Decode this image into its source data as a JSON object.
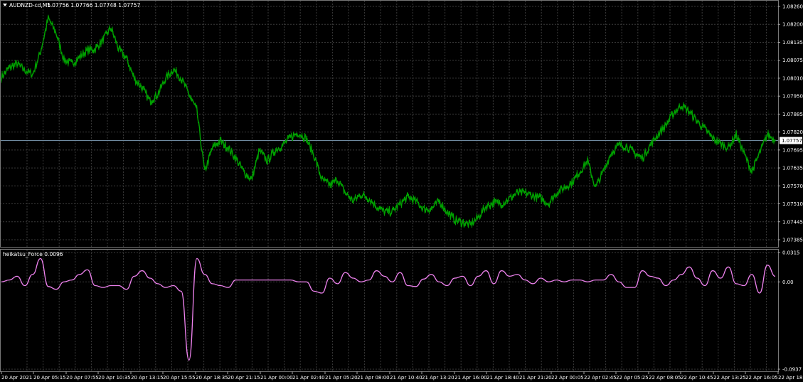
{
  "header": {
    "symbol_label": "AUDNZD-cd,M5",
    "ohlc_label": "1.07756 1.07766 1.07748 1.07757"
  },
  "indicator": {
    "label": "heikatsu_Force 0.0096"
  },
  "colors": {
    "background": "#000000",
    "grid": "#3a3a3a",
    "price_line": "#00a000",
    "indicator_line": "#ee82ee",
    "current_price_line": "#6f8aa0"
  },
  "chart_data": [
    {
      "type": "line",
      "title": "AUDNZD-cd,M5",
      "yticks": [
        "1.08260",
        "1.08200",
        "1.08135",
        "1.08075",
        "1.08010",
        "1.07950",
        "1.07885",
        "1.07820",
        "1.07695",
        "1.07635",
        "1.07570",
        "1.07510",
        "1.07445",
        "1.07385"
      ],
      "current_price": "1.07757",
      "ylim": [
        1.07385,
        1.0826
      ],
      "grid": true,
      "x": [
        0,
        1,
        2,
        3,
        4,
        5,
        6,
        7,
        8,
        9,
        10,
        11,
        12,
        13,
        14,
        15,
        16,
        17,
        18,
        19,
        20,
        21,
        22,
        23,
        24,
        25,
        26,
        27,
        28,
        29,
        30,
        31,
        32,
        33,
        34,
        35,
        36,
        37,
        38,
        39,
        40,
        41,
        42,
        43,
        44,
        45,
        46,
        47,
        48,
        49,
        50,
        51,
        52,
        53,
        54,
        55,
        56,
        57,
        58,
        59,
        60,
        61,
        62,
        63,
        64,
        65,
        66,
        67,
        68,
        69,
        70,
        71,
        72,
        73,
        74,
        75,
        76,
        77,
        78,
        79,
        80,
        81,
        82,
        83,
        84,
        85,
        86,
        87,
        88,
        89,
        90,
        91,
        92,
        93,
        94,
        95,
        96,
        97,
        98,
        99
      ],
      "values": [
        1.07995,
        1.0803,
        1.08045,
        1.0802,
        1.08005,
        1.0809,
        1.08215,
        1.0816,
        1.0806,
        1.08045,
        1.0807,
        1.08095,
        1.081,
        1.08135,
        1.0818,
        1.081,
        1.08065,
        1.0799,
        1.07955,
        1.07905,
        1.0793,
        1.0799,
        1.08025,
        1.0799,
        1.0793,
        1.0787,
        1.0764,
        1.0773,
        1.07755,
        1.0773,
        1.0769,
        1.0764,
        1.0761,
        1.0772,
        1.0768,
        1.0772,
        1.0774,
        1.0777,
        1.07785,
        1.07765,
        1.077,
        1.0761,
        1.0759,
        1.0761,
        1.0756,
        1.0753,
        1.07555,
        1.0754,
        1.0751,
        1.0749,
        1.0749,
        1.0752,
        1.07545,
        1.0753,
        1.075,
        1.075,
        1.0753,
        1.0749,
        1.0746,
        1.0745,
        1.0744,
        1.0747,
        1.0751,
        1.07525,
        1.0752,
        1.0754,
        1.0756,
        1.0756,
        1.0755,
        1.0754,
        1.0752,
        1.0756,
        1.0758,
        1.076,
        1.0764,
        1.0768,
        1.0758,
        1.0764,
        1.0771,
        1.0774,
        1.07735,
        1.0771,
        1.0769,
        1.0774,
        1.0778,
        1.07815,
        1.0786,
        1.0789,
        1.07865,
        1.0783,
        1.078,
        1.07765,
        1.07745,
        1.0773,
        1.0778,
        1.0771,
        1.0764,
        1.0771,
        1.0778,
        1.07757
      ]
    },
    {
      "type": "line",
      "title": "heikatsu_Force 0.0096",
      "yticks": [
        "0.0315",
        "0.00",
        "-0.0937"
      ],
      "ylim": [
        -0.0937,
        0.0315
      ],
      "grid": true,
      "x": [
        0,
        1,
        2,
        3,
        4,
        5,
        6,
        7,
        8,
        9,
        10,
        11,
        12,
        13,
        14,
        15,
        16,
        17,
        18,
        19,
        20,
        21,
        22,
        23,
        24,
        25,
        26,
        27,
        28,
        29,
        30,
        31,
        32,
        33,
        34,
        35,
        36,
        37,
        38,
        39,
        40,
        41,
        42,
        43,
        44,
        45,
        46,
        47,
        48,
        49,
        50,
        51,
        52,
        53,
        54,
        55,
        56,
        57,
        58,
        59,
        60,
        61,
        62,
        63,
        64,
        65,
        66,
        67,
        68,
        69,
        70,
        71,
        72,
        73,
        74,
        75,
        76,
        77,
        78,
        79,
        80,
        81,
        82,
        83,
        84,
        85,
        86,
        87,
        88,
        89,
        90,
        91,
        92,
        93,
        94,
        95,
        96,
        97,
        98,
        99
      ],
      "values": [
        0.0,
        0.002,
        0.006,
        -0.004,
        0.008,
        0.025,
        -0.005,
        -0.008,
        0.0,
        0.002,
        0.008,
        0.013,
        -0.004,
        -0.006,
        -0.004,
        -0.004,
        -0.008,
        0.006,
        0.012,
        0.004,
        -0.002,
        -0.006,
        -0.004,
        -0.01,
        -0.084,
        0.025,
        0.008,
        -0.002,
        -0.004,
        -0.006,
        0.002,
        0.002,
        0.002,
        0.002,
        0.002,
        0.002,
        0.002,
        0.002,
        0.0,
        0.0,
        -0.01,
        -0.012,
        0.004,
        -0.002,
        0.01,
        0.004,
        0.0,
        0.002,
        0.012,
        0.006,
        0.0,
        0.01,
        -0.004,
        -0.005,
        0.003,
        0.008,
        0.0,
        -0.004,
        0.004,
        0.006,
        -0.004,
        0.006,
        0.012,
        -0.002,
        0.012,
        0.006,
        0.008,
        0.002,
        -0.002,
        0.004,
        0.0,
        0.002,
        0.0,
        0.002,
        0.002,
        0.0,
        0.002,
        0.002,
        0.008,
        0.0,
        -0.006,
        -0.006,
        0.012,
        0.006,
        0.004,
        -0.004,
        0.002,
        0.008,
        0.016,
        0.004,
        -0.004,
        0.012,
        0.004,
        0.016,
        -0.002,
        -0.004,
        0.008,
        -0.012,
        0.018,
        0.006
      ]
    }
  ],
  "time_labels": [
    "20 Apr 2021",
    "20 Apr 05:15",
    "20 Apr 07:55",
    "20 Apr 10:35",
    "20 Apr 13:15",
    "20 Apr 15:55",
    "20 Apr 18:35",
    "20 Apr 21:15",
    "21 Apr 00:00",
    "21 Apr 02:40",
    "21 Apr 05:20",
    "21 Apr 08:00",
    "21 Apr 10:40",
    "21 Apr 13:20",
    "21 Apr 16:00",
    "21 Apr 18:40",
    "21 Apr 21:20",
    "22 Apr 00:05",
    "22 Apr 02:45",
    "22 Apr 05:25",
    "22 Apr 08:05",
    "22 Apr 10:45",
    "22 Apr 13:25",
    "22 Apr 16:05",
    "22 Apr 18:45"
  ]
}
